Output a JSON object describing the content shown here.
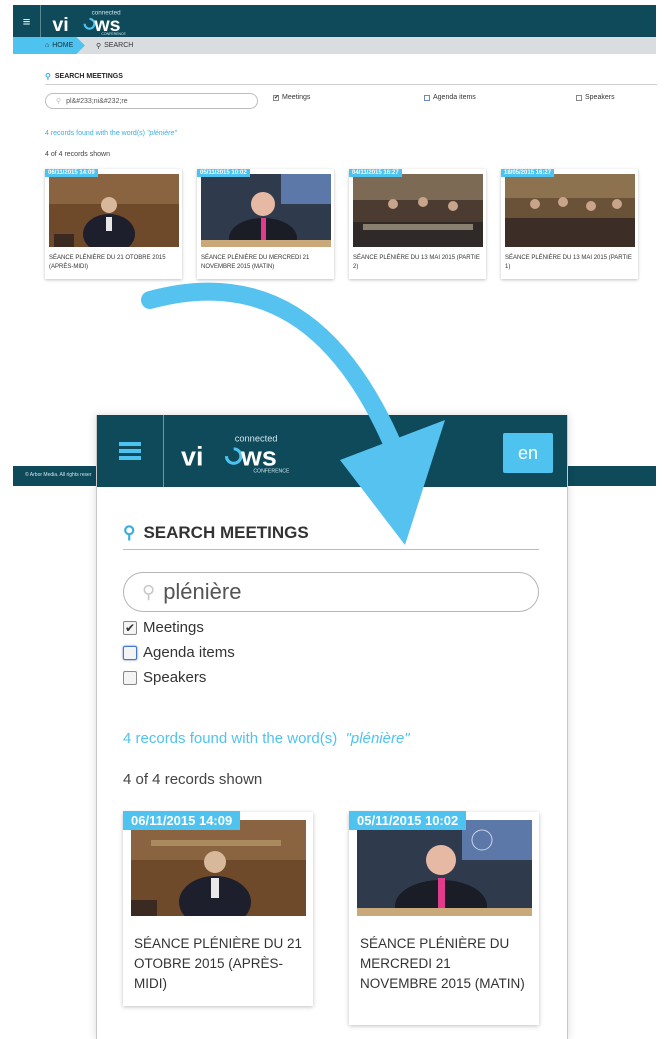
{
  "brand": {
    "logo_small": "connected",
    "logo_main_left": "vi",
    "logo_main_right": "ws",
    "logo_sub": "CONFERENCE"
  },
  "desktop": {
    "breadcrumb": {
      "home": "HOME",
      "search": "SEARCH"
    },
    "title": "SEARCH MEETINGS",
    "search_value": "pl&#233;ni&#232;re",
    "filters": [
      {
        "label": "Meetings",
        "checked": true
      },
      {
        "label": "Agenda items",
        "checked": false
      },
      {
        "label": "Speakers",
        "checked": false
      }
    ],
    "found_text": "4 records found with the word(s)",
    "found_word": "\"plénière\"",
    "shown_text": "4 of 4 records shown",
    "results": [
      {
        "date": "06/11/2015 14:09",
        "title": "SÉANCE PLÉNIÈRE DU 21 OTOBRE 2015 (APRÈS-MIDI)"
      },
      {
        "date": "05/11/2015 10:02",
        "title": "SÉANCE PLÉNIÈRE DU MERCREDI 21 NOVEMBRE 2015 (MATIN)"
      },
      {
        "date": "04/11/2015 16:27",
        "title": "SÉANCE PLÉNIÈRE DU 13 MAI 2015 (PARTIE 2)"
      },
      {
        "date": "18/05/2015 16:27",
        "title": "SÉANCE PLÉNIÈRE DU 13 MAI 2015 (PARTIE 1)"
      }
    ],
    "footer": "© Arbor Media. All rights reser"
  },
  "mobile": {
    "language": "en",
    "title": "SEARCH MEETINGS",
    "search_value": "plénière",
    "filters": [
      {
        "label": "Meetings",
        "checked": true
      },
      {
        "label": "Agenda items",
        "checked": false
      },
      {
        "label": "Speakers",
        "checked": false
      }
    ],
    "found_text": "4 records found with the word(s)",
    "found_word": "\"plénière\"",
    "shown_text": "4 of 4 records shown",
    "results": [
      {
        "date": "06/11/2015 14:09",
        "title": "SÉANCE PLÉNIÈRE DU 21 OTOBRE 2015 (APRÈS-MIDI)"
      },
      {
        "date": "05/11/2015 10:02",
        "title": "SÉANCE PLÉNIÈRE DU MERCREDI 21 NOVEMBRE 2015 (MATIN)"
      }
    ]
  },
  "icons": {
    "menu": "hamburger-menu-icon",
    "home": "home-icon",
    "search": "search-icon",
    "arrow": "curved-arrow-icon"
  },
  "colors": {
    "header": "#0e4a5a",
    "accent": "#4fc3ef",
    "link": "#3aaee0"
  }
}
